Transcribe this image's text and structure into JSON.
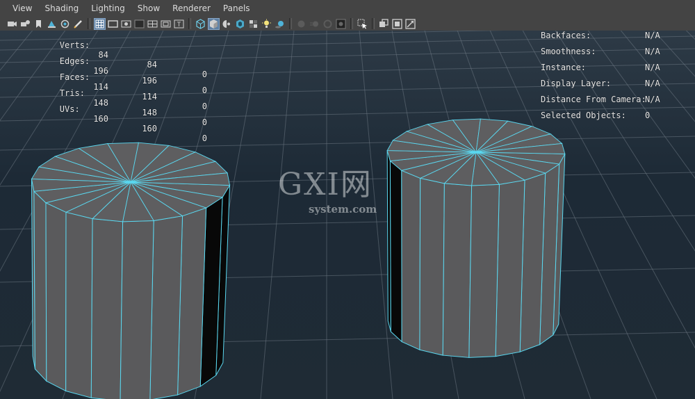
{
  "menu": {
    "items": [
      "View",
      "Shading",
      "Lighting",
      "Show",
      "Renderer",
      "Panels"
    ]
  },
  "toolbar": {
    "icons": [
      "camera-icon",
      "camera-attributes-icon",
      "bookmark-icon",
      "image-plane-icon",
      "2d-pan-icon",
      "grease-pencil-icon",
      "grid-icon",
      "film-gate-icon",
      "resolution-gate-icon",
      "gate-mask-icon",
      "field-chart-icon",
      "safe-action-icon",
      "safe-title-icon",
      "wireframe-icon",
      "smooth-shade-icon",
      "default-material-icon",
      "xray-joints-icon",
      "texture-icon",
      "lights-icon",
      "shadows-icon",
      "screen-space-ao-icon",
      "motion-blur-icon",
      "multisample-aa-icon",
      "depth-of-field-icon",
      "isolate-select-icon",
      "xray-icon",
      "xray-active-icon",
      "xray-components-icon"
    ]
  },
  "hud": {
    "left": [
      {
        "label": "Verts:",
        "v1": "84",
        "v2": "84",
        "v3": "0"
      },
      {
        "label": "Edges:",
        "v1": "196",
        "v2": "196",
        "v3": "0"
      },
      {
        "label": "Faces:",
        "v1": "114",
        "v2": "114",
        "v3": "0"
      },
      {
        "label": "Tris:",
        "v1": "148",
        "v2": "148",
        "v3": "0"
      },
      {
        "label": "UVs:",
        "v1": "160",
        "v2": "160",
        "v3": "0"
      }
    ],
    "right": [
      {
        "label": "Backfaces:",
        "value": "N/A"
      },
      {
        "label": "Smoothness:",
        "value": "N/A"
      },
      {
        "label": "Instance:",
        "value": "N/A"
      },
      {
        "label": "Display Layer:",
        "value": "N/A"
      },
      {
        "label": "Distance From Camera:",
        "value": "N/A"
      },
      {
        "label": "Selected Objects:",
        "value": "0"
      }
    ]
  },
  "watermark": {
    "big": "GXI网",
    "small": "system.com"
  },
  "colors": {
    "wire": "#5ad8f0",
    "body": "#5a5a5c",
    "grid": "#6a7580"
  }
}
